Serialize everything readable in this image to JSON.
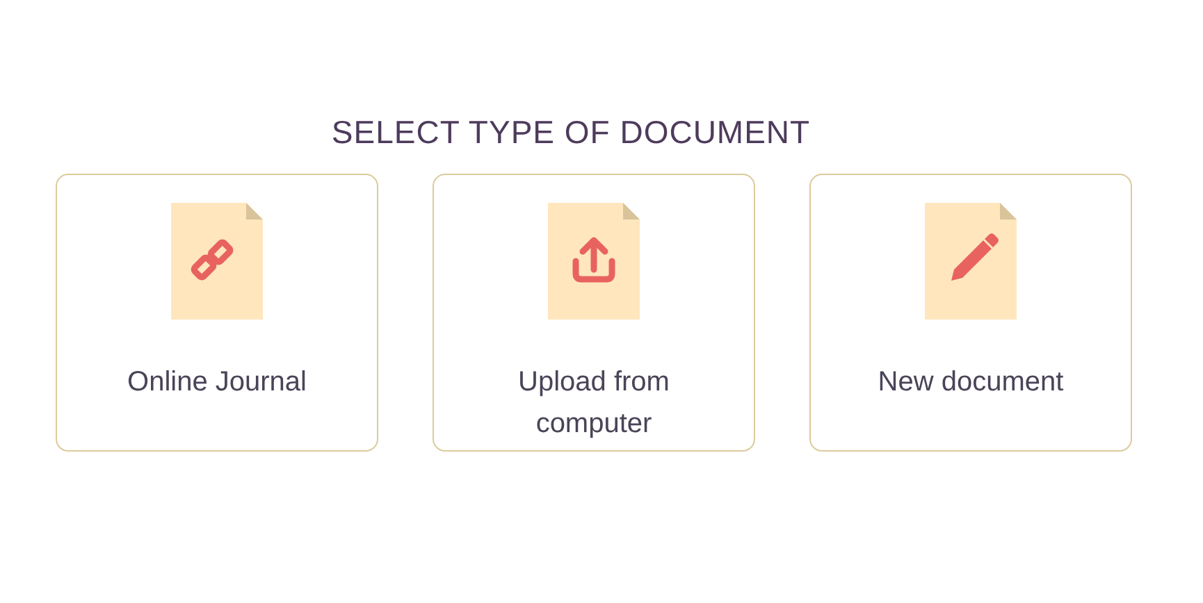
{
  "heading": "SELECT TYPE OF DOCUMENT",
  "options": [
    {
      "kind": "link",
      "label": "Online Journal"
    },
    {
      "kind": "upload",
      "label": "Upload from computer"
    },
    {
      "kind": "pencil",
      "label": "New document"
    }
  ]
}
